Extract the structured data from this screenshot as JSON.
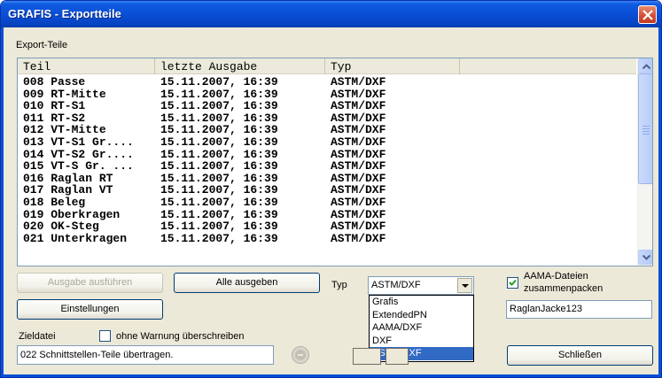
{
  "window": {
    "title": "GRAFIS - Exportteile"
  },
  "export_group": {
    "label": "Export-Teile"
  },
  "list": {
    "columns": [
      "Teil",
      "letzte Ausgabe",
      "Typ"
    ],
    "rows": [
      [
        "008 Passe",
        "15.11.2007, 16:39",
        "ASTM/DXF"
      ],
      [
        "009 RT-Mitte",
        "15.11.2007, 16:39",
        "ASTM/DXF"
      ],
      [
        "010 RT-S1",
        "15.11.2007, 16:39",
        "ASTM/DXF"
      ],
      [
        "011 RT-S2",
        "15.11.2007, 16:39",
        "ASTM/DXF"
      ],
      [
        "012 VT-Mitte",
        "15.11.2007, 16:39",
        "ASTM/DXF"
      ],
      [
        "013 VT-S1 Gr....",
        "15.11.2007, 16:39",
        "ASTM/DXF"
      ],
      [
        "014 VT-S2 Gr....",
        "15.11.2007, 16:39",
        "ASTM/DXF"
      ],
      [
        "015 VT-S Gr. ...",
        "15.11.2007, 16:39",
        "ASTM/DXF"
      ],
      [
        "016 Raglan RT",
        "15.11.2007, 16:39",
        "ASTM/DXF"
      ],
      [
        "017 Raglan VT",
        "15.11.2007, 16:39",
        "ASTM/DXF"
      ],
      [
        "018 Beleg",
        "15.11.2007, 16:39",
        "ASTM/DXF"
      ],
      [
        "019 Oberkragen",
        "15.11.2007, 16:39",
        "ASTM/DXF"
      ],
      [
        "020 OK-Steg",
        "15.11.2007, 16:39",
        "ASTM/DXF"
      ],
      [
        "021 Unterkragen",
        "15.11.2007, 16:39",
        "ASTM/DXF"
      ]
    ]
  },
  "buttons": {
    "run_export": "Ausgabe ausführen",
    "export_all": "Alle ausgeben",
    "settings": "Einstellungen",
    "close": "Schließen"
  },
  "type": {
    "label": "Typ",
    "selected": "ASTM/DXF",
    "options": [
      "Grafis",
      "ExtendedPN",
      "AAMA/DXF",
      "DXF",
      "ASTM/DXF"
    ],
    "highlighted_index": 4
  },
  "aama": {
    "label_line1": "AAMA-Dateien",
    "label_line2": "zusammenpacken",
    "checked": true
  },
  "archive_name": {
    "value": "RaglanJacke123"
  },
  "target": {
    "label": "Zieldatei",
    "overwrite_label": "ohne Warnung überschreiben",
    "overwrite_checked": false
  },
  "status": {
    "text": "022 Schnittstellen-Teile übertragen."
  },
  "colors": {
    "titlebar": "#0a4fd6",
    "selection": "#316ac5",
    "dialog_bg": "#ece9d8"
  },
  "icons": {
    "close": "close-x-icon",
    "stop": "stop-icon"
  }
}
